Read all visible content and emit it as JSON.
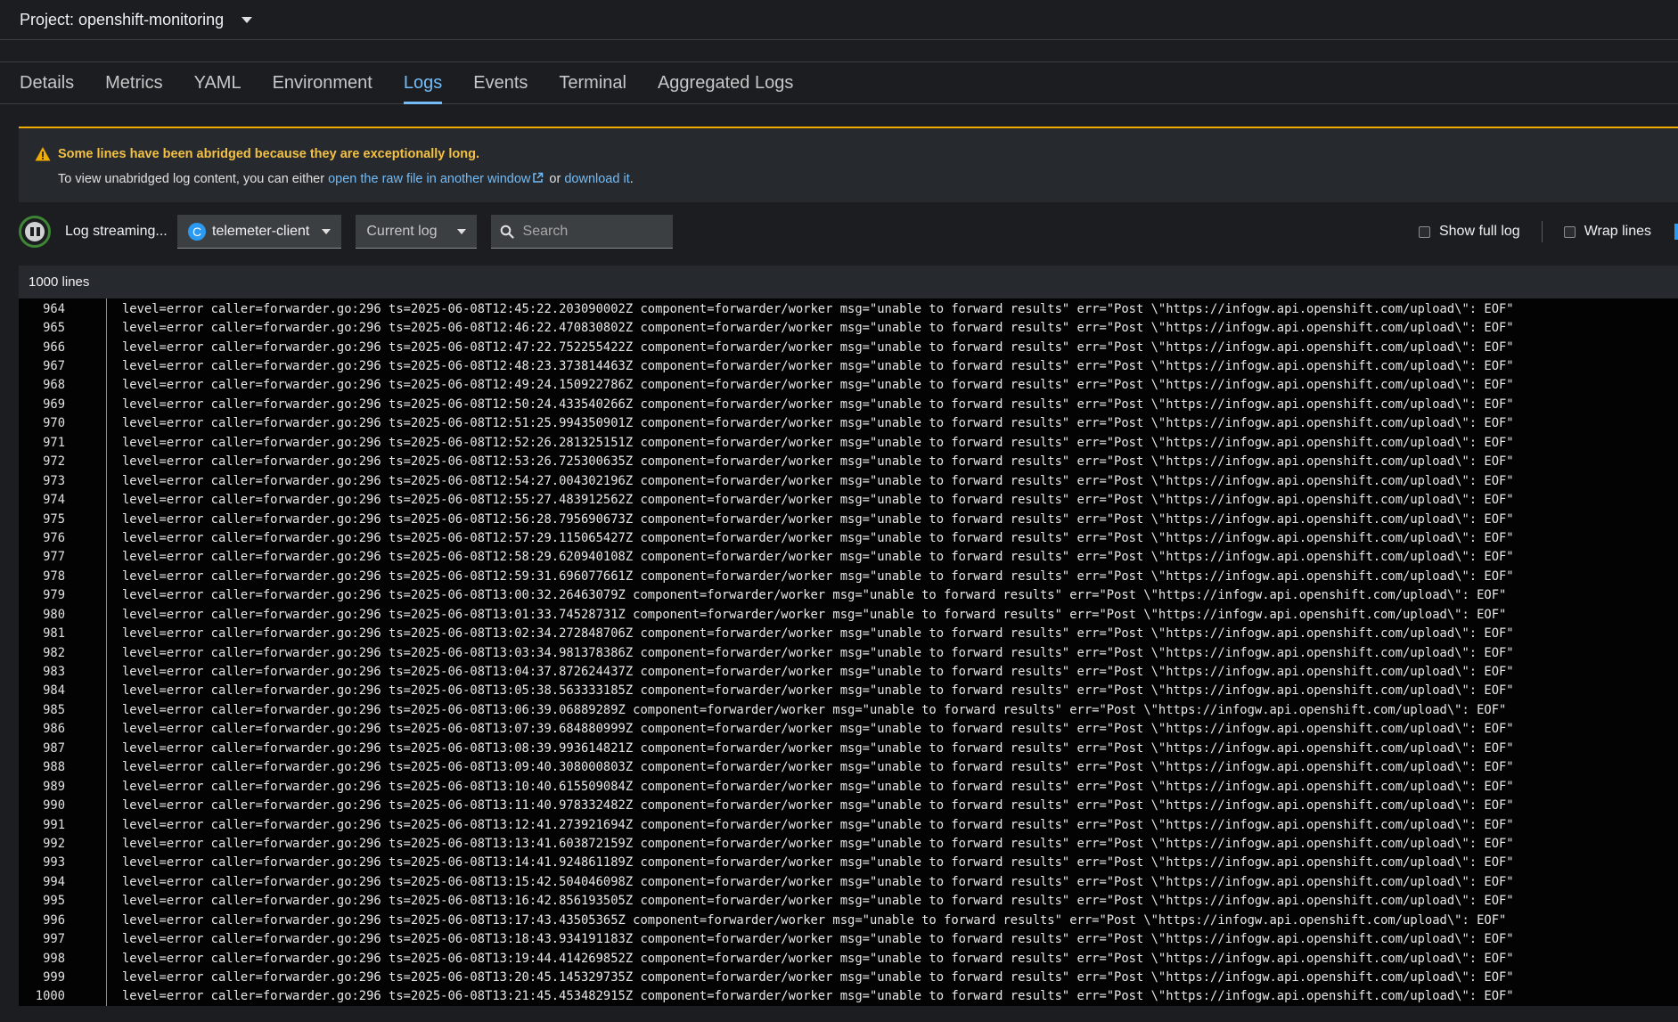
{
  "project": {
    "label": "Project: openshift-monitoring"
  },
  "tabs": [
    {
      "label": "Details"
    },
    {
      "label": "Metrics"
    },
    {
      "label": "YAML"
    },
    {
      "label": "Environment"
    },
    {
      "label": "Logs"
    },
    {
      "label": "Events"
    },
    {
      "label": "Terminal"
    },
    {
      "label": "Aggregated Logs"
    }
  ],
  "active_tab": "Logs",
  "alert": {
    "title": "Some lines have been abridged because they are exceptionally long.",
    "body_prefix": "To view unabridged log content, you can either ",
    "link_raw": "open the raw file in another window",
    "body_mid": " or ",
    "link_download": "download it",
    "body_suffix": "."
  },
  "toolbar": {
    "streaming_label": "Log streaming...",
    "container_badge": "C",
    "container_name": "telemeter-client",
    "log_select": "Current log",
    "search_placeholder": "Search",
    "show_full_log": "Show full log",
    "wrap_lines": "Wrap lines"
  },
  "lines_count": "1000 lines",
  "logs": [
    {
      "num": "964",
      "text": "level=error caller=forwarder.go:296 ts=2025-06-08T12:45:22.203090002Z component=forwarder/worker msg=\"unable to forward results\" err=\"Post \\\"https://infogw.api.openshift.com/upload\\\": EOF\""
    },
    {
      "num": "965",
      "text": "level=error caller=forwarder.go:296 ts=2025-06-08T12:46:22.470830802Z component=forwarder/worker msg=\"unable to forward results\" err=\"Post \\\"https://infogw.api.openshift.com/upload\\\": EOF\""
    },
    {
      "num": "966",
      "text": "level=error caller=forwarder.go:296 ts=2025-06-08T12:47:22.752255422Z component=forwarder/worker msg=\"unable to forward results\" err=\"Post \\\"https://infogw.api.openshift.com/upload\\\": EOF\""
    },
    {
      "num": "967",
      "text": "level=error caller=forwarder.go:296 ts=2025-06-08T12:48:23.373814463Z component=forwarder/worker msg=\"unable to forward results\" err=\"Post \\\"https://infogw.api.openshift.com/upload\\\": EOF\""
    },
    {
      "num": "968",
      "text": "level=error caller=forwarder.go:296 ts=2025-06-08T12:49:24.150922786Z component=forwarder/worker msg=\"unable to forward results\" err=\"Post \\\"https://infogw.api.openshift.com/upload\\\": EOF\""
    },
    {
      "num": "969",
      "text": "level=error caller=forwarder.go:296 ts=2025-06-08T12:50:24.433540266Z component=forwarder/worker msg=\"unable to forward results\" err=\"Post \\\"https://infogw.api.openshift.com/upload\\\": EOF\""
    },
    {
      "num": "970",
      "text": "level=error caller=forwarder.go:296 ts=2025-06-08T12:51:25.994350901Z component=forwarder/worker msg=\"unable to forward results\" err=\"Post \\\"https://infogw.api.openshift.com/upload\\\": EOF\""
    },
    {
      "num": "971",
      "text": "level=error caller=forwarder.go:296 ts=2025-06-08T12:52:26.281325151Z component=forwarder/worker msg=\"unable to forward results\" err=\"Post \\\"https://infogw.api.openshift.com/upload\\\": EOF\""
    },
    {
      "num": "972",
      "text": "level=error caller=forwarder.go:296 ts=2025-06-08T12:53:26.725300635Z component=forwarder/worker msg=\"unable to forward results\" err=\"Post \\\"https://infogw.api.openshift.com/upload\\\": EOF\""
    },
    {
      "num": "973",
      "text": "level=error caller=forwarder.go:296 ts=2025-06-08T12:54:27.004302196Z component=forwarder/worker msg=\"unable to forward results\" err=\"Post \\\"https://infogw.api.openshift.com/upload\\\": EOF\""
    },
    {
      "num": "974",
      "text": "level=error caller=forwarder.go:296 ts=2025-06-08T12:55:27.483912562Z component=forwarder/worker msg=\"unable to forward results\" err=\"Post \\\"https://infogw.api.openshift.com/upload\\\": EOF\""
    },
    {
      "num": "975",
      "text": "level=error caller=forwarder.go:296 ts=2025-06-08T12:56:28.795690673Z component=forwarder/worker msg=\"unable to forward results\" err=\"Post \\\"https://infogw.api.openshift.com/upload\\\": EOF\""
    },
    {
      "num": "976",
      "text": "level=error caller=forwarder.go:296 ts=2025-06-08T12:57:29.115065427Z component=forwarder/worker msg=\"unable to forward results\" err=\"Post \\\"https://infogw.api.openshift.com/upload\\\": EOF\""
    },
    {
      "num": "977",
      "text": "level=error caller=forwarder.go:296 ts=2025-06-08T12:58:29.620940108Z component=forwarder/worker msg=\"unable to forward results\" err=\"Post \\\"https://infogw.api.openshift.com/upload\\\": EOF\""
    },
    {
      "num": "978",
      "text": "level=error caller=forwarder.go:296 ts=2025-06-08T12:59:31.696077661Z component=forwarder/worker msg=\"unable to forward results\" err=\"Post \\\"https://infogw.api.openshift.com/upload\\\": EOF\""
    },
    {
      "num": "979",
      "text": "level=error caller=forwarder.go:296 ts=2025-06-08T13:00:32.26463079Z component=forwarder/worker msg=\"unable to forward results\" err=\"Post \\\"https://infogw.api.openshift.com/upload\\\": EOF\""
    },
    {
      "num": "980",
      "text": "level=error caller=forwarder.go:296 ts=2025-06-08T13:01:33.74528731Z component=forwarder/worker msg=\"unable to forward results\" err=\"Post \\\"https://infogw.api.openshift.com/upload\\\": EOF\""
    },
    {
      "num": "981",
      "text": "level=error caller=forwarder.go:296 ts=2025-06-08T13:02:34.272848706Z component=forwarder/worker msg=\"unable to forward results\" err=\"Post \\\"https://infogw.api.openshift.com/upload\\\": EOF\""
    },
    {
      "num": "982",
      "text": "level=error caller=forwarder.go:296 ts=2025-06-08T13:03:34.981378386Z component=forwarder/worker msg=\"unable to forward results\" err=\"Post \\\"https://infogw.api.openshift.com/upload\\\": EOF\""
    },
    {
      "num": "983",
      "text": "level=error caller=forwarder.go:296 ts=2025-06-08T13:04:37.872624437Z component=forwarder/worker msg=\"unable to forward results\" err=\"Post \\\"https://infogw.api.openshift.com/upload\\\": EOF\""
    },
    {
      "num": "984",
      "text": "level=error caller=forwarder.go:296 ts=2025-06-08T13:05:38.563333185Z component=forwarder/worker msg=\"unable to forward results\" err=\"Post \\\"https://infogw.api.openshift.com/upload\\\": EOF\""
    },
    {
      "num": "985",
      "text": "level=error caller=forwarder.go:296 ts=2025-06-08T13:06:39.06889289Z component=forwarder/worker msg=\"unable to forward results\" err=\"Post \\\"https://infogw.api.openshift.com/upload\\\": EOF\""
    },
    {
      "num": "986",
      "text": "level=error caller=forwarder.go:296 ts=2025-06-08T13:07:39.684880999Z component=forwarder/worker msg=\"unable to forward results\" err=\"Post \\\"https://infogw.api.openshift.com/upload\\\": EOF\""
    },
    {
      "num": "987",
      "text": "level=error caller=forwarder.go:296 ts=2025-06-08T13:08:39.993614821Z component=forwarder/worker msg=\"unable to forward results\" err=\"Post \\\"https://infogw.api.openshift.com/upload\\\": EOF\""
    },
    {
      "num": "988",
      "text": "level=error caller=forwarder.go:296 ts=2025-06-08T13:09:40.308000803Z component=forwarder/worker msg=\"unable to forward results\" err=\"Post \\\"https://infogw.api.openshift.com/upload\\\": EOF\""
    },
    {
      "num": "989",
      "text": "level=error caller=forwarder.go:296 ts=2025-06-08T13:10:40.615509084Z component=forwarder/worker msg=\"unable to forward results\" err=\"Post \\\"https://infogw.api.openshift.com/upload\\\": EOF\""
    },
    {
      "num": "990",
      "text": "level=error caller=forwarder.go:296 ts=2025-06-08T13:11:40.978332482Z component=forwarder/worker msg=\"unable to forward results\" err=\"Post \\\"https://infogw.api.openshift.com/upload\\\": EOF\""
    },
    {
      "num": "991",
      "text": "level=error caller=forwarder.go:296 ts=2025-06-08T13:12:41.273921694Z component=forwarder/worker msg=\"unable to forward results\" err=\"Post \\\"https://infogw.api.openshift.com/upload\\\": EOF\""
    },
    {
      "num": "992",
      "text": "level=error caller=forwarder.go:296 ts=2025-06-08T13:13:41.603872159Z component=forwarder/worker msg=\"unable to forward results\" err=\"Post \\\"https://infogw.api.openshift.com/upload\\\": EOF\""
    },
    {
      "num": "993",
      "text": "level=error caller=forwarder.go:296 ts=2025-06-08T13:14:41.924861189Z component=forwarder/worker msg=\"unable to forward results\" err=\"Post \\\"https://infogw.api.openshift.com/upload\\\": EOF\""
    },
    {
      "num": "994",
      "text": "level=error caller=forwarder.go:296 ts=2025-06-08T13:15:42.504046098Z component=forwarder/worker msg=\"unable to forward results\" err=\"Post \\\"https://infogw.api.openshift.com/upload\\\": EOF\""
    },
    {
      "num": "995",
      "text": "level=error caller=forwarder.go:296 ts=2025-06-08T13:16:42.856193505Z component=forwarder/worker msg=\"unable to forward results\" err=\"Post \\\"https://infogw.api.openshift.com/upload\\\": EOF\""
    },
    {
      "num": "996",
      "text": "level=error caller=forwarder.go:296 ts=2025-06-08T13:17:43.43505365Z component=forwarder/worker msg=\"unable to forward results\" err=\"Post \\\"https://infogw.api.openshift.com/upload\\\": EOF\""
    },
    {
      "num": "997",
      "text": "level=error caller=forwarder.go:296 ts=2025-06-08T13:18:43.934191183Z component=forwarder/worker msg=\"unable to forward results\" err=\"Post \\\"https://infogw.api.openshift.com/upload\\\": EOF\""
    },
    {
      "num": "998",
      "text": "level=error caller=forwarder.go:296 ts=2025-06-08T13:19:44.414269852Z component=forwarder/worker msg=\"unable to forward results\" err=\"Post \\\"https://infogw.api.openshift.com/upload\\\": EOF\""
    },
    {
      "num": "999",
      "text": "level=error caller=forwarder.go:296 ts=2025-06-08T13:20:45.145329735Z component=forwarder/worker msg=\"unable to forward results\" err=\"Post \\\"https://infogw.api.openshift.com/upload\\\": EOF\""
    },
    {
      "num": "1000",
      "text": "level=error caller=forwarder.go:296 ts=2025-06-08T13:21:45.453482915Z component=forwarder/worker msg=\"unable to forward results\" err=\"Post \\\"https://infogw.api.openshift.com/upload\\\": EOF\""
    }
  ],
  "colors": {
    "accent": "#73bcf7",
    "warning": "#f0ab00",
    "streaming_ring": "#3e8635",
    "badge": "#2b9af3"
  }
}
